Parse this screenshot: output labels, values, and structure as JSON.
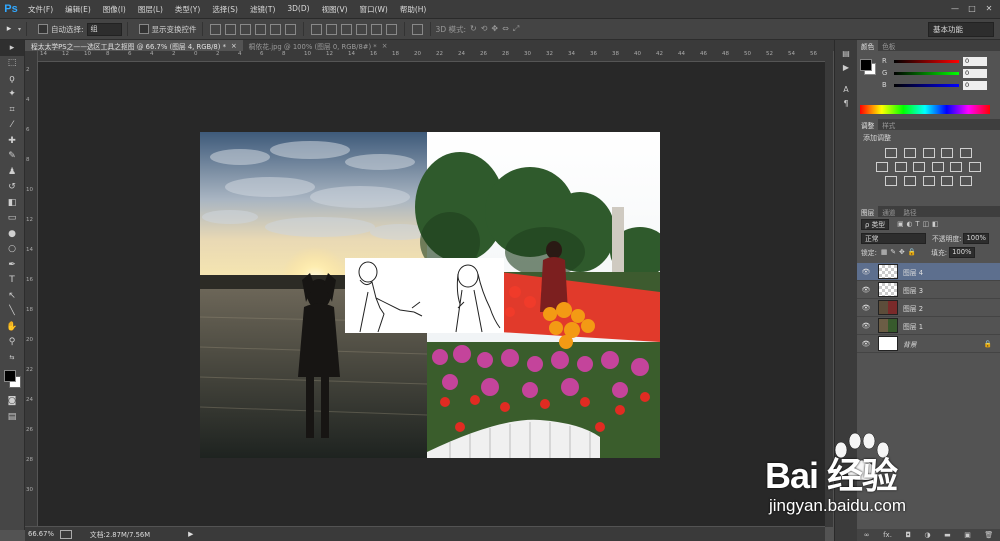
{
  "app": {
    "logo": "Ps"
  },
  "menu": [
    "文件(F)",
    "编辑(E)",
    "图像(I)",
    "图层(L)",
    "类型(Y)",
    "选择(S)",
    "滤镜(T)",
    "3D(D)",
    "视图(V)",
    "窗口(W)",
    "帮助(H)"
  ],
  "window_controls": [
    "—",
    "□",
    "✕"
  ],
  "options": {
    "auto_select_label": "自动选择:",
    "auto_select_value": "组",
    "show_transform_label": "显示变换控件",
    "mode_3d_label": "3D 模式:",
    "workspace": "基本功能"
  },
  "tabs": [
    {
      "label": "程太太学PS之——选区工具之抠图 @ 66.7% (图层 4, RGB/8) *",
      "active": true,
      "close": "×"
    },
    {
      "label": "桐依花.jpg @ 100% (图层 0, RGB/8#) *",
      "active": false,
      "close": "×"
    }
  ],
  "ruler_h": [
    "14",
    "12",
    "10",
    "8",
    "6",
    "4",
    "2",
    "0",
    "2",
    "4",
    "6",
    "8",
    "10",
    "12",
    "14",
    "16",
    "18",
    "20",
    "22",
    "24",
    "26",
    "28",
    "30",
    "32",
    "34",
    "36",
    "38",
    "40",
    "42",
    "44",
    "46",
    "48",
    "50",
    "52",
    "54",
    "56"
  ],
  "ruler_v": [
    "2",
    "4",
    "6",
    "8",
    "10",
    "12",
    "14",
    "16",
    "18",
    "20",
    "22",
    "24",
    "26",
    "28",
    "30"
  ],
  "status": {
    "zoom": "66.67%",
    "doc": "文档:2.87M/7.56M",
    "arrow": "▶"
  },
  "color_panel": {
    "tabs": [
      "颜色",
      "色板"
    ],
    "rows": [
      {
        "label": "R",
        "value": "0"
      },
      {
        "label": "G",
        "value": "0"
      },
      {
        "label": "B",
        "value": "0"
      }
    ]
  },
  "adjust_panel": {
    "tabs": [
      "调整",
      "样式"
    ],
    "title": "添加调整"
  },
  "layers_panel": {
    "tabs": [
      "图层",
      "通道",
      "路径"
    ],
    "kind_label": "ρ 类型",
    "blend_mode": "正常",
    "opacity_label": "不透明度:",
    "opacity_value": "100%",
    "lock_label": "锁定:",
    "fill_label": "填充:",
    "fill_value": "100%",
    "layers": [
      {
        "name": "图层 4",
        "selected": true,
        "thumb": "checker"
      },
      {
        "name": "图层 3",
        "selected": false,
        "thumb": "checker"
      },
      {
        "name": "图层 2",
        "selected": false,
        "thumb": "photo"
      },
      {
        "name": "图层 1",
        "selected": false,
        "thumb": "photo2"
      },
      {
        "name": "背景",
        "selected": false,
        "thumb": "white",
        "locked": true
      }
    ],
    "bottom_icons": [
      "∞",
      "fx.",
      "◘",
      "◑",
      "▬",
      "▣",
      "🗑"
    ]
  },
  "watermark": {
    "text": "Bai 经验",
    "url": "jingyan.baidu.com"
  },
  "colors": {
    "accent": "#31a8ff",
    "bg": "#535353",
    "selected_layer": "#5d6f8e",
    "canvas_bg": "#282828"
  }
}
